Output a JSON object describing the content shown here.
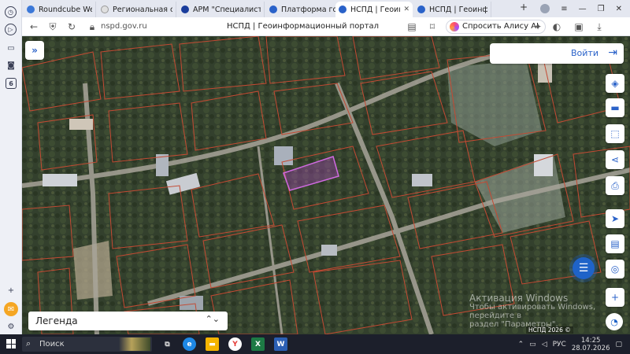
{
  "browser": {
    "tabs": [
      {
        "label": "Roundcube Webmail",
        "icon_color": "#3c78d8",
        "active": false
      },
      {
        "label": "Региональная систе",
        "icon_color": "#e0e0e0",
        "active": false
      },
      {
        "label": "АРМ \"Специалист\"",
        "icon_color": "#1a3d9c",
        "active": false
      },
      {
        "label": "Платформа государ",
        "icon_color": "#2a62c9",
        "active": false
      },
      {
        "label": "НСПД | Геоинформ",
        "icon_color": "#2a62c9",
        "active": true
      },
      {
        "label": "НСПД | Геоинформ",
        "icon_color": "#2a62c9",
        "active": false
      }
    ],
    "new_tab": "+",
    "url": "nspd.gov.ru",
    "page_title": "НСПД | Геоинформационный портал",
    "alice_label": "Спросить Алису AI",
    "sidebar_badge": "6"
  },
  "map": {
    "login_label": "Войти",
    "legend_label": "Легенда",
    "watermark_line1": "Активация Windows",
    "watermark_line2": "Чтобы активировать Windows, перейдите в",
    "watermark_line3": "раздел \"Параметры\".",
    "copyright": "НСПД 2026 ©"
  },
  "taskbar": {
    "search_placeholder": "Поиск",
    "language": "РУС",
    "time": "14:25",
    "date": "28.07.2026"
  },
  "colors": {
    "accent": "#2a62c9",
    "highlight_parcel": "#b44bc7",
    "parcel_lines": "#c44a33"
  }
}
